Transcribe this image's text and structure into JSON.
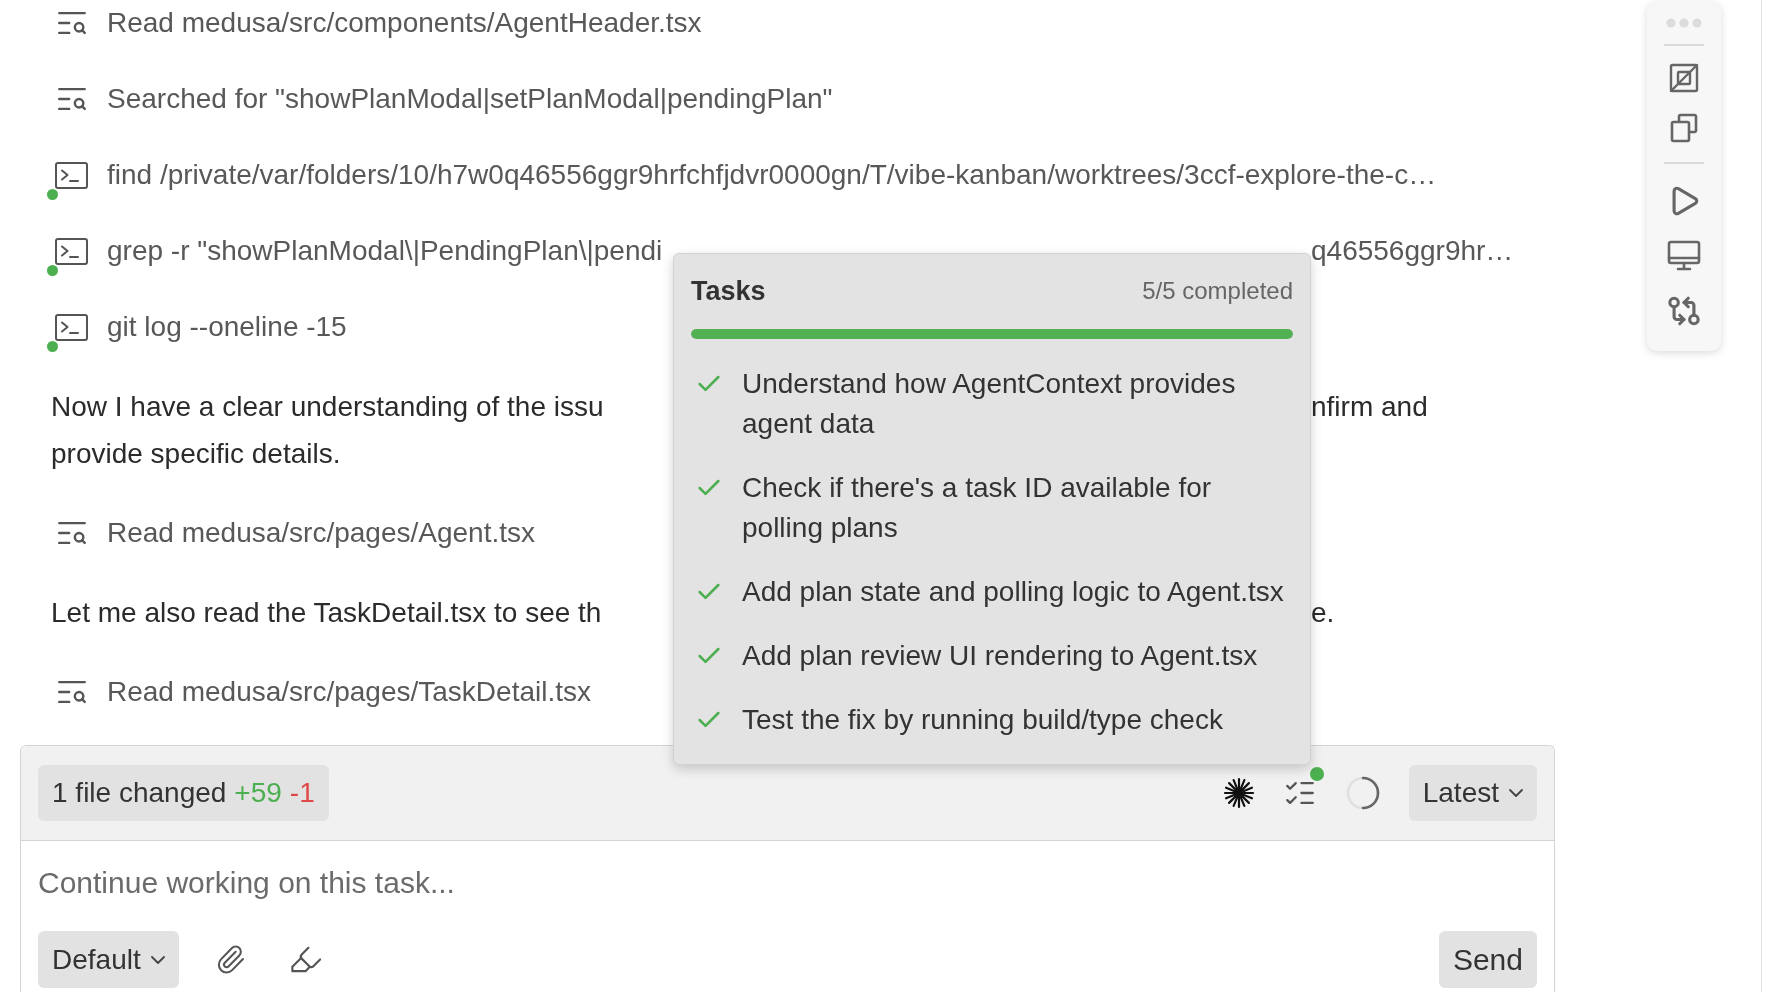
{
  "transcript": [
    {
      "kind": "read",
      "text": "Read medusa/src/components/AgentHeader.tsx"
    },
    {
      "kind": "search",
      "text": "Searched for \"showPlanModal|setPlanModal|pendingPlan\""
    },
    {
      "kind": "command",
      "color": "#4caf50",
      "text": "find /private/var/folders/10/h7w0q46556ggr9hrfchfjdvr0000gn/T/vibe-kanban/worktrees/3ccf-explore-the-c…"
    },
    {
      "kind": "command",
      "color": "#4caf50",
      "parts": [
        "grep -r \"showPlanModal\\|PendingPlan\\|pendi",
        "q46556ggr9hr…"
      ]
    },
    {
      "kind": "command",
      "color": "#4caf50",
      "text": "git log --oneline -15"
    },
    {
      "kind": "message",
      "lines": [
        {
          "parts": [
            "Now I have a clear understanding of the issu",
            "nfirm and"
          ]
        },
        {
          "text": "provide specific details."
        }
      ]
    },
    {
      "kind": "read",
      "text": "Read medusa/src/pages/Agent.tsx"
    },
    {
      "kind": "message",
      "lines": [
        {
          "parts": [
            "Let me also read the TaskDetail.tsx to see th",
            "e."
          ]
        }
      ]
    },
    {
      "kind": "read",
      "text": "Read medusa/src/pages/TaskDetail.tsx"
    }
  ],
  "tasks_popover": {
    "title": "Tasks",
    "summary": "5/5 completed",
    "level": 1,
    "items": [
      {
        "text": "Understand how AgentContext provides agent data",
        "completed": true
      },
      {
        "text": "Check if there's a task ID available for polling plans",
        "completed": true
      },
      {
        "text": "Add plan state and polling logic to Agent.tsx",
        "completed": true
      },
      {
        "text": "Add plan review UI rendering to Agent.tsx",
        "completed": true
      },
      {
        "text": "Test the fix by running build/type check",
        "completed": true
      }
    ]
  },
  "composer": {
    "changes": {
      "label": "1 file changed",
      "additions": "+59",
      "deletions": "-1"
    },
    "tasks_button": {
      "notification": true
    },
    "view_select": "Latest",
    "placeholder": "Continue working on this task...",
    "mode_select": "Default",
    "send_button": "Send"
  }
}
